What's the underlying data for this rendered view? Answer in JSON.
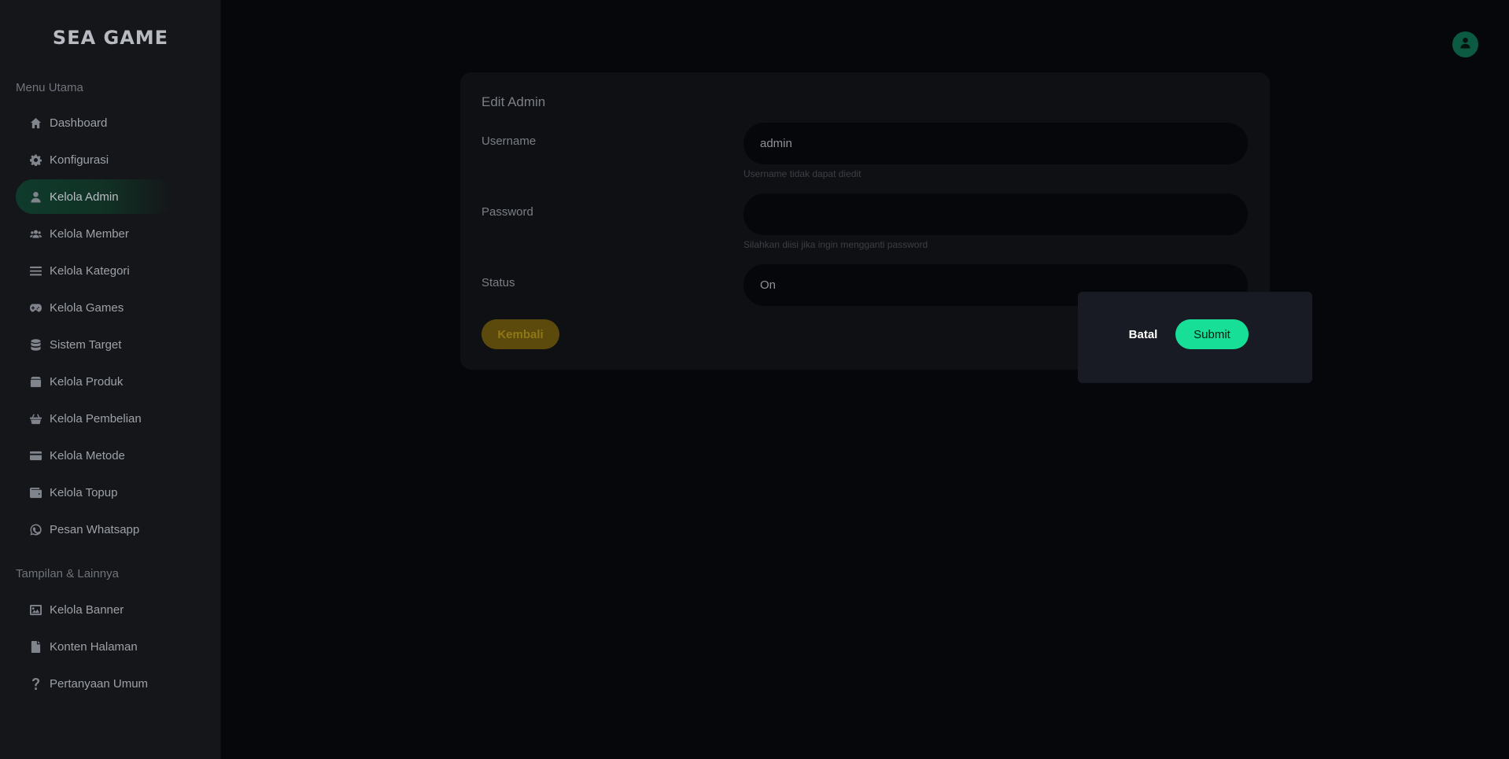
{
  "brand": {
    "logo_text": "SEA GAME"
  },
  "sidebar": {
    "section_main": "Menu Utama",
    "section_other": "Tampilan & Lainnya",
    "items": [
      {
        "label": "Dashboard",
        "icon": "home-icon"
      },
      {
        "label": "Konfigurasi",
        "icon": "gear-icon"
      },
      {
        "label": "Kelola Admin",
        "icon": "user-icon",
        "active": true
      },
      {
        "label": "Kelola Member",
        "icon": "users-icon"
      },
      {
        "label": "Kelola Kategori",
        "icon": "list-icon"
      },
      {
        "label": "Kelola Games",
        "icon": "gamepad-icon"
      },
      {
        "label": "Sistem Target",
        "icon": "database-icon"
      },
      {
        "label": "Kelola Produk",
        "icon": "box-icon"
      },
      {
        "label": "Kelola Pembelian",
        "icon": "basket-icon"
      },
      {
        "label": "Kelola Metode",
        "icon": "credit-card-icon"
      },
      {
        "label": "Kelola Topup",
        "icon": "wallet-icon"
      },
      {
        "label": "Pesan Whatsapp",
        "icon": "whatsapp-icon"
      }
    ],
    "other_items": [
      {
        "label": "Kelola Banner",
        "icon": "image-icon"
      },
      {
        "label": "Konten Halaman",
        "icon": "file-icon"
      },
      {
        "label": "Pertanyaan Umum",
        "icon": "question-icon"
      }
    ]
  },
  "header": {
    "avatar_icon": "user-circle-icon"
  },
  "form": {
    "title": "Edit Admin",
    "username_label": "Username",
    "username_value": "admin",
    "username_help": "Username tidak dapat diedit",
    "password_label": "Password",
    "password_value": "",
    "password_help": "Silahkan diisi jika ingin mengganti password",
    "status_label": "Status",
    "status_value": "On",
    "back_label": "Kembali"
  },
  "dialog": {
    "cancel_label": "Batal",
    "submit_label": "Submit"
  },
  "colors": {
    "accent": "#17df98",
    "active_nav": "#0f3b2c",
    "back_button": "#5c4a0c",
    "background": "#06070b",
    "sidebar": "#141619"
  }
}
